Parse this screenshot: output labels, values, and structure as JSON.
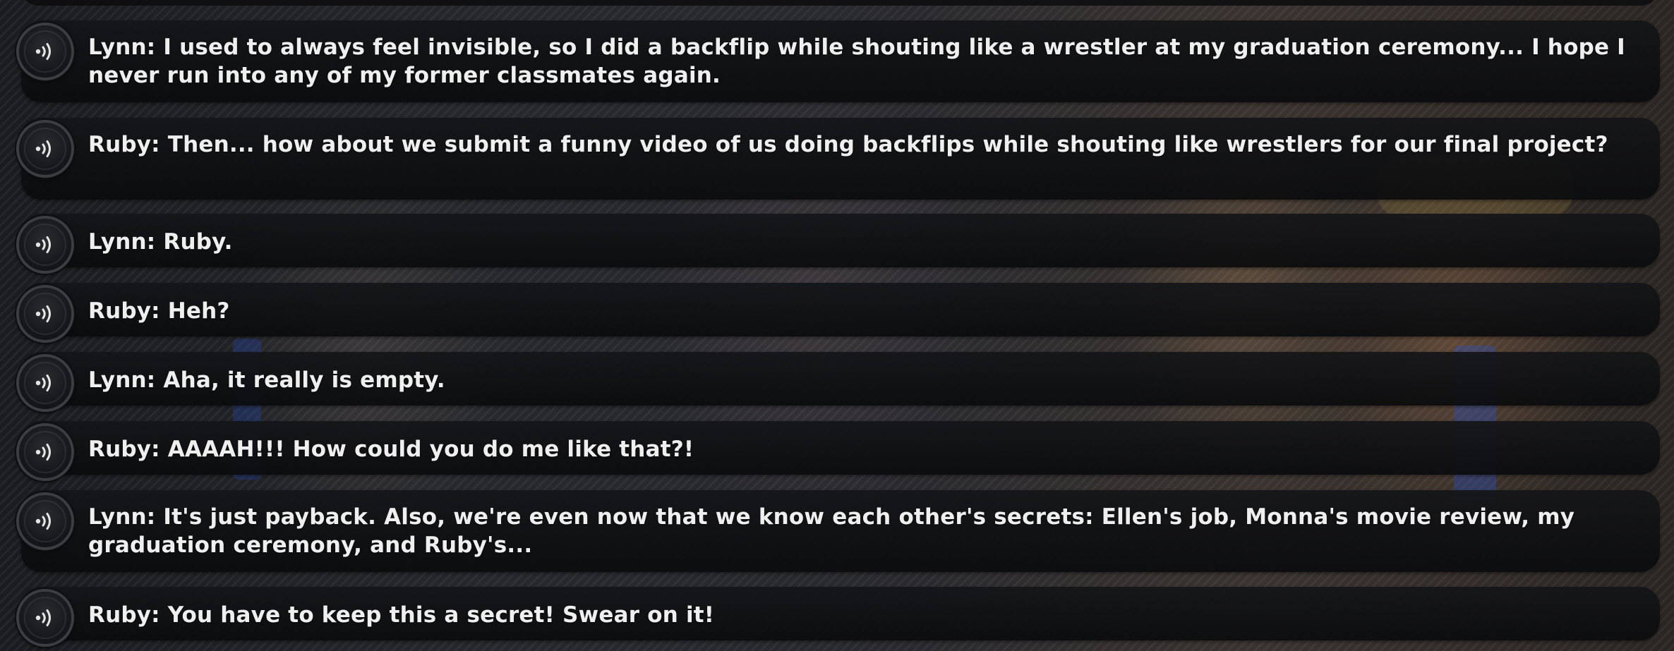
{
  "dialogue_log": {
    "entries": [
      {
        "speaker": "Lynn",
        "text": "Lynn: I used to always feel invisible, so I did a backflip while shouting like a wrestler at my graduation ceremony... I hope I never run into any of my former classmates again."
      },
      {
        "speaker": "Ruby",
        "text": "Ruby: Then... how about we submit a funny video of us doing backflips while shouting like wrestlers for our final project?"
      },
      {
        "speaker": "Lynn",
        "text": "Lynn: Ruby."
      },
      {
        "speaker": "Ruby",
        "text": "Ruby: Heh?"
      },
      {
        "speaker": "Lynn",
        "text": "Lynn: Aha, it really is empty."
      },
      {
        "speaker": "Ruby",
        "text": "Ruby: AAAAH!!! How could you do me like that?!"
      },
      {
        "speaker": "Lynn",
        "text": "Lynn: It's just payback. Also, we're even now that we know each other's secrets: Ellen's job, Monna's movie review, my graduation ceremony, and Ruby's..."
      },
      {
        "speaker": "Ruby",
        "text": "Ruby: You have to keep this a secret! Swear on it!"
      }
    ],
    "voice_button_icon": "sound-wave-icon"
  }
}
